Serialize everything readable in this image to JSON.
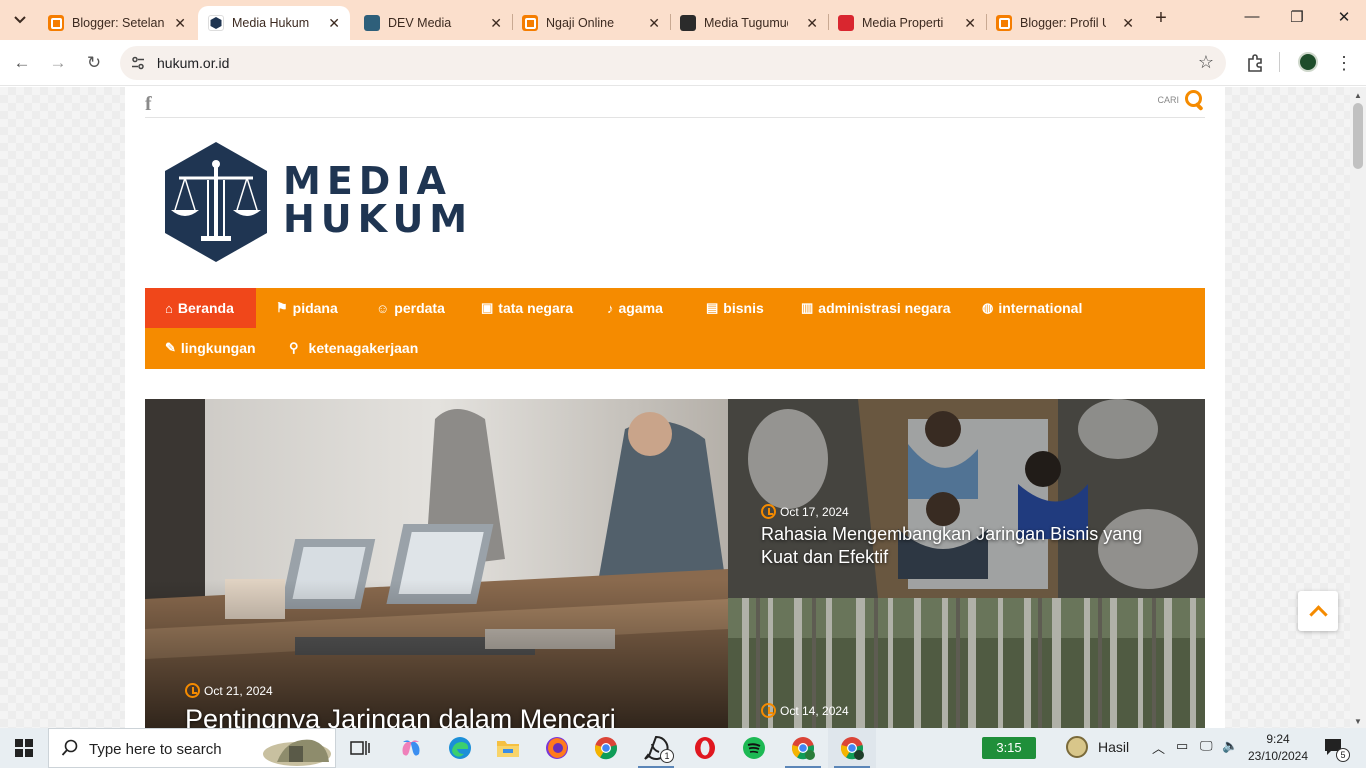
{
  "browser": {
    "tabs": [
      {
        "title": "Blogger: Setelan",
        "favicon": "blogger-icon",
        "active": false
      },
      {
        "title": "Media Hukum",
        "favicon": "media-hukum-icon",
        "active": true
      },
      {
        "title": "DEV Media",
        "favicon": "dev-media-icon",
        "active": false
      },
      {
        "title": "Ngaji Online",
        "favicon": "blogger-icon",
        "active": false
      },
      {
        "title": "Media Tugumuda",
        "favicon": "tugumuda-icon",
        "active": false
      },
      {
        "title": "Media Properti",
        "favicon": "properti-icon",
        "active": false
      },
      {
        "title": "Blogger: Profil U",
        "favicon": "blogger-icon",
        "active": false
      }
    ],
    "url": "hukum.or.id"
  },
  "site": {
    "search_label": "CARI",
    "logo": {
      "line1": "MEDIA",
      "line2": "HUKUM"
    },
    "menu": [
      {
        "label": "Beranda",
        "icon": "home-icon",
        "glyph": "⌂",
        "active": true
      },
      {
        "label": "pidana",
        "icon": "pidana-icon",
        "glyph": "⚑",
        "active": false
      },
      {
        "label": "perdata",
        "icon": "perdata-icon",
        "glyph": "☺",
        "active": false
      },
      {
        "label": "tata negara",
        "icon": "tata-negara-icon",
        "glyph": "▣",
        "active": false
      },
      {
        "label": "agama",
        "icon": "bell-icon",
        "glyph": "♪",
        "active": false
      },
      {
        "label": "bisnis",
        "icon": "briefcase-icon",
        "glyph": "▤",
        "active": false
      },
      {
        "label": "administrasi negara",
        "icon": "lock-icon",
        "glyph": "▥",
        "active": false
      },
      {
        "label": "international",
        "icon": "globe-icon",
        "glyph": "◍",
        "active": false
      },
      {
        "label": "lingkungan",
        "icon": "leaf-icon",
        "glyph": "✎",
        "active": false
      },
      {
        "label": "ketenagakerjaan",
        "icon": "pin-icon",
        "glyph": "⚲",
        "active": false
      }
    ],
    "featured": [
      {
        "date": "Oct 21, 2024",
        "title": "Pentingnya Jaringan dalam Mencari"
      },
      {
        "date": "Oct 17, 2024",
        "title": "Rahasia Mengembangkan Jaringan Bisnis yang Kuat dan Efektif"
      },
      {
        "date": "Oct 14, 2024",
        "title": ""
      }
    ]
  },
  "taskbar": {
    "search_placeholder": "Type here to search",
    "timer": "3:15",
    "widget_label": "Hasil",
    "time": "9:24",
    "date": "23/10/2024",
    "whatsapp_badge": "1",
    "notification_count": "5"
  },
  "colors": {
    "brand_orange": "#f58b00",
    "active_menu": "#f0471a",
    "logo_navy": "#1f3552",
    "tab_strip": "#fbdfcc"
  }
}
